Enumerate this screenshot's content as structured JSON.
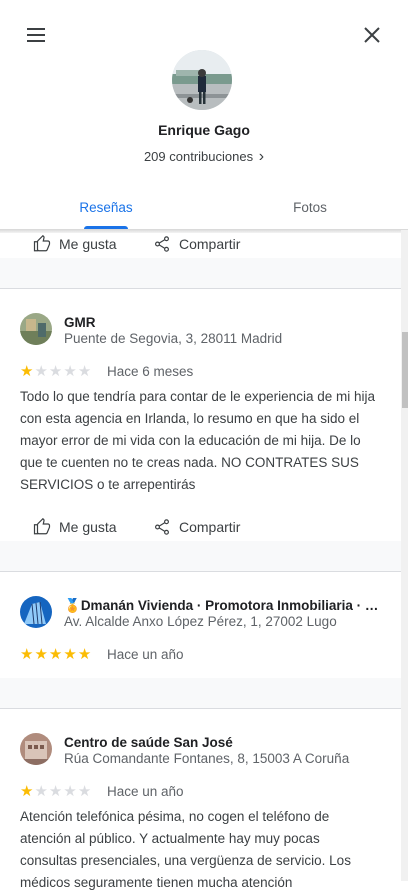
{
  "header": {
    "name": "Enrique Gago",
    "contributions": "209 contribuciones",
    "contributions_chevron": "›"
  },
  "tabs": [
    {
      "label": "Reseñas",
      "active": true
    },
    {
      "label": "Fotos",
      "active": false
    }
  ],
  "actions": {
    "like": "Me gusta",
    "share": "Compartir"
  },
  "reviews": [
    {
      "place": "GMR",
      "address": "Puente de Segovia, 3, 28011 Madrid",
      "rating": 1,
      "time": "Hace 6 meses",
      "text": "Todo lo que tendría para contar de le experiencia de mi hija con esta agencia en Irlanda, lo resumo en que ha sido el mayor error de mi vida con la educación de mi hija. De lo que te cuenten no te creas nada. NO CONTRATES SUS SERVICIOS o te arrepentirás"
    },
    {
      "badge": "🏅",
      "place": "Dmanán Vivienda · Promotora Inmobiliaria · G...",
      "address": "Av. Alcalde Anxo López Pérez, 1, 27002 Lugo",
      "rating": 5,
      "time": "Hace un año",
      "text": ""
    },
    {
      "place": "Centro de saúde San José",
      "address": "Rúa Comandante Fontanes, 8, 15003 A Coruña",
      "rating": 1,
      "time": "Hace un año",
      "text": "Atención telefónica pésima, no cogen el teléfono de atención al público. Y actualmente hay muy pocas consultas presenciales, una vergüenza de servicio. Los médicos seguramente tienen mucha atención"
    }
  ],
  "colors": {
    "accent": "#1a73e8",
    "star": "#fbbc04",
    "star_empty": "#dadce0"
  },
  "icons": [
    "menu-icon",
    "close-icon",
    "thumb-up-icon",
    "share-icon",
    "medal-icon"
  ]
}
